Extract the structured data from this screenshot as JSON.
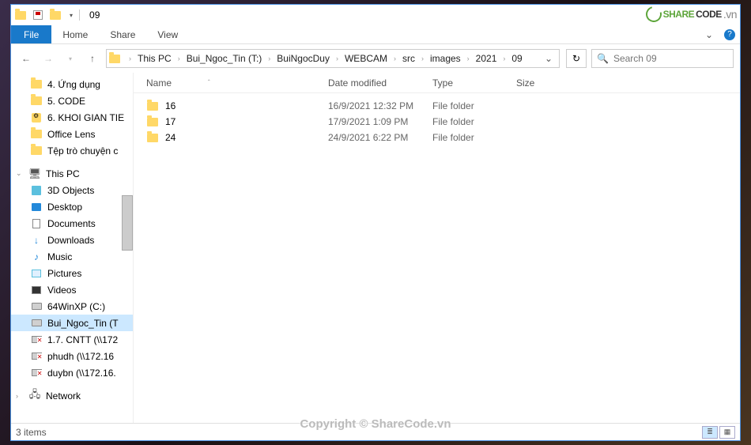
{
  "window": {
    "title": "09"
  },
  "ribbon": {
    "file": "File",
    "tabs": [
      "Home",
      "Share",
      "View"
    ]
  },
  "breadcrumbs": [
    "This PC",
    "Bui_Ngoc_Tin (T:)",
    "BuiNgocDuy",
    "WEBCAM",
    "src",
    "images",
    "2021",
    "09"
  ],
  "search": {
    "placeholder": "Search 09"
  },
  "sidebar": {
    "quick": [
      "4. Ứng dụng",
      "5. CODE",
      "6. KHOI GIAN TIE",
      "Office Lens",
      "Tệp trò chuyện c"
    ],
    "thispc_label": "This PC",
    "thispc": [
      {
        "label": "3D Objects",
        "icon": "3d"
      },
      {
        "label": "Desktop",
        "icon": "desktop"
      },
      {
        "label": "Documents",
        "icon": "doc"
      },
      {
        "label": "Downloads",
        "icon": "down"
      },
      {
        "label": "Music",
        "icon": "music"
      },
      {
        "label": "Pictures",
        "icon": "pic"
      },
      {
        "label": "Videos",
        "icon": "vid"
      },
      {
        "label": "64WinXP  (C:)",
        "icon": "drive"
      },
      {
        "label": "Bui_Ngoc_Tin (T",
        "icon": "drive",
        "selected": true
      },
      {
        "label": "1.7. CNTT (\\\\172",
        "icon": "netdrive"
      },
      {
        "label": "phudh (\\\\172.16",
        "icon": "netdrive"
      },
      {
        "label": "duybn (\\\\172.16.",
        "icon": "netdrive"
      }
    ],
    "network_label": "Network"
  },
  "columns": {
    "name": "Name",
    "date": "Date modified",
    "type": "Type",
    "size": "Size"
  },
  "rows": [
    {
      "name": "16",
      "date": "16/9/2021 12:32 PM",
      "type": "File folder"
    },
    {
      "name": "17",
      "date": "17/9/2021 1:09 PM",
      "type": "File folder"
    },
    {
      "name": "24",
      "date": "24/9/2021 6:22 PM",
      "type": "File folder"
    }
  ],
  "status": {
    "count": "3 items"
  },
  "watermark": {
    "brand_left": "SHARE",
    "brand_right": "CODE",
    "suffix": ".vn",
    "center": "Copyright © ShareCode.vn"
  }
}
